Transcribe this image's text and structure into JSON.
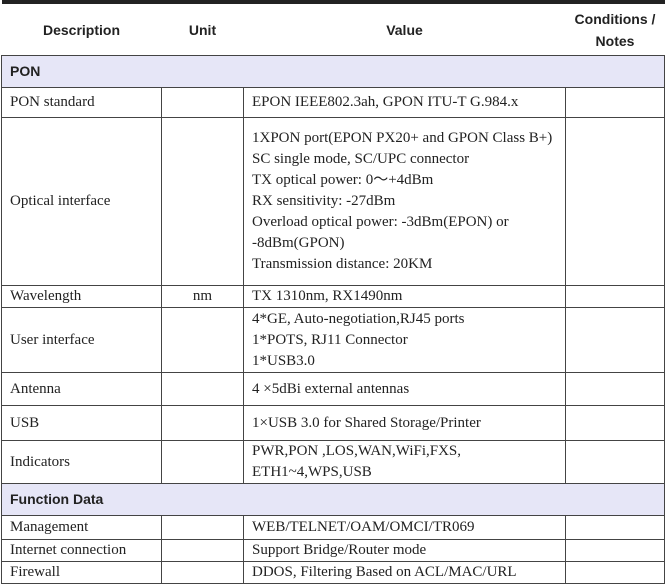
{
  "headers": {
    "description": "Description",
    "unit": "Unit",
    "value": "Value",
    "notes_1": "Conditions /",
    "notes_2": "Notes"
  },
  "sections": [
    {
      "title": "PON",
      "rows": [
        {
          "description": "PON standard",
          "unit": "",
          "value": [
            "EPON IEEE802.3ah, GPON ITU-T G.984.x"
          ]
        },
        {
          "description": "Optical interface",
          "unit": "",
          "value": [
            "1XPON port(EPON PX20+ and GPON Class B+)",
            "SC single mode, SC/UPC connector",
            "TX optical power: 0～+4dBm",
            "RX sensitivity: -27dBm",
            "Overload optical power: -3dBm(EPON) or -8dBm(GPON)",
            "Transmission distance: 20KM"
          ]
        },
        {
          "description": "Wavelength",
          "unit": "nm",
          "value": [
            "TX 1310nm, RX1490nm"
          ]
        },
        {
          "description": "User interface",
          "unit": "",
          "value": [
            "4*GE, Auto-negotiation,RJ45 ports",
            "1*POTS, RJ11 Connector",
            "1*USB3.0"
          ]
        },
        {
          "description": "Antenna",
          "unit": "",
          "value": [
            "4 ×5dBi    external antennas"
          ]
        },
        {
          "description": "USB",
          "unit": "",
          "value": [
            "1×USB 3.0 for Shared Storage/Printer"
          ]
        },
        {
          "description": "Indicators",
          "unit": "",
          "value": [
            "PWR,PON ,LOS,WAN,WiFi,FXS, ETH1~4,WPS,USB"
          ]
        }
      ]
    },
    {
      "title": "Function Data",
      "rows": [
        {
          "description": "Management",
          "unit": "",
          "value": [
            "WEB/TELNET/OAM/OMCI/TR069"
          ]
        },
        {
          "description": "Internet connection",
          "unit": "",
          "value": [
            "Support Bridge/Router mode"
          ]
        },
        {
          "description": "Firewall",
          "unit": "",
          "value": [
            "DDOS, Filtering Based on ACL/MAC/URL"
          ]
        }
      ]
    }
  ]
}
